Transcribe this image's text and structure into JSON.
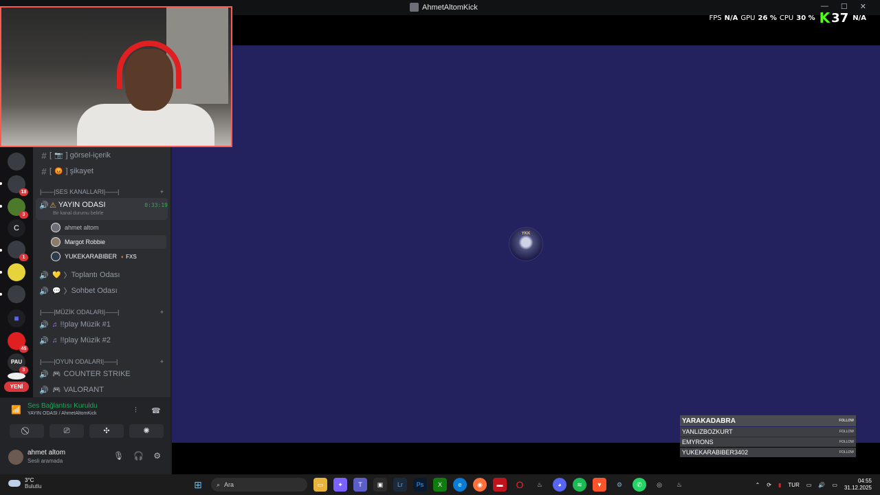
{
  "window": {
    "title": "AhmetAltomKick"
  },
  "overlay": {
    "fps_label": "FPS",
    "fps_value": "N/A",
    "gpu_label": "GPU",
    "gpu_value": "26 %",
    "cpu_label": "CPU",
    "cpu_value": "30 %",
    "kick_count": "37",
    "na": "N/A"
  },
  "channels": {
    "text": [
      {
        "name": "görsel-içerik",
        "emoji": "📷"
      },
      {
        "name": "şikayet",
        "emoji": "😡"
      }
    ],
    "voice_category": "|——|SES KANALLARI|——|",
    "active_voice": {
      "name": "YAYIN ODASI",
      "status": "Bir kanal durumu belirle",
      "timer": "0:33:19"
    },
    "voice_users": [
      {
        "name": "ahmet altom"
      },
      {
        "name": "Margot Robbie"
      },
      {
        "name": "YUKEKARABIBER",
        "tag": "FXS"
      }
    ],
    "other_voice": [
      {
        "name": "Toplantı Odası",
        "emoji": "💛"
      },
      {
        "name": "Sohbet Odası",
        "emoji": "💬"
      }
    ],
    "music_category": "|——|MÜZİK ODALARI|——|",
    "music": [
      {
        "name": "!!play Müzik #1"
      },
      {
        "name": "!!play Müzik #2"
      }
    ],
    "game_category": "|——|OYUN ODALARI|——|",
    "games": [
      {
        "name": "COUNTER STRIKE"
      },
      {
        "name": "VALORANT"
      }
    ]
  },
  "guild_badges": {
    "g1": "18",
    "g2": "3",
    "g3": "1",
    "g4": "45",
    "g5": "3",
    "letter_c": "C",
    "pau": "PAU",
    "yeni": "YENİ"
  },
  "voice_bar": {
    "status": "Ses Bağlantısı Kuruldu",
    "sub": "YAYIN ODASI / AhmetAltomKick"
  },
  "user": {
    "name": "ahmet altom",
    "status": "Sesli aramada"
  },
  "stage": {
    "avatar_label": "YKK"
  },
  "follows": [
    {
      "name": "YARAKADABRA",
      "btn": "FOLLOW"
    },
    {
      "name": "YANLIZBOZKURT",
      "btn": "FOLLOW"
    },
    {
      "name": "EMYRONS",
      "btn": "FOLLOW"
    },
    {
      "name": "YUKEKARABIBER3402",
      "btn": "FOLLOW"
    }
  ],
  "taskbar": {
    "weather_temp": "3°C",
    "weather_desc": "Bulutlu",
    "search_placeholder": "Ara",
    "lang": "TUR",
    "time": "04:55",
    "date": "31.12.2025"
  },
  "colors": {
    "stage_bg": "#24215f",
    "cam_border": "#ff5a4d",
    "kick_green": "#53fc18",
    "connected_green": "#23a55a"
  }
}
